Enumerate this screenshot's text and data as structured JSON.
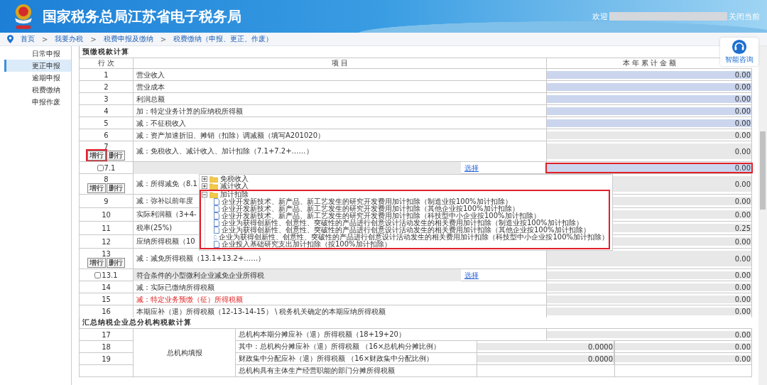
{
  "header": {
    "title": "国家税务总局江苏省电子税务局",
    "welcome": "欢迎",
    "close_link": "关闭当前"
  },
  "breadcrumb": {
    "separator": ">",
    "items": [
      "首页",
      "我要办税",
      "税费申报及缴纳",
      "税费缴纳（申报、更正、作废）"
    ]
  },
  "sidebar": {
    "items": [
      {
        "label": "日常申报",
        "selected": false
      },
      {
        "label": "更正申报",
        "selected": true
      },
      {
        "label": "逾期申报",
        "selected": false
      },
      {
        "label": "税费缴纳",
        "selected": false
      },
      {
        "label": "申报作废",
        "selected": false
      }
    ]
  },
  "help": {
    "label": "智能咨询"
  },
  "section1": {
    "title": "预缴税款计算",
    "columns": [
      "行 次",
      "项 目",
      "本 年 累 计 金 额"
    ],
    "rows": [
      {
        "no": "1",
        "item": "营业收入",
        "amount": "0.00",
        "kind": "prefilled"
      },
      {
        "no": "2",
        "item": "营业成本",
        "amount": "0.00",
        "kind": "prefilled"
      },
      {
        "no": "3",
        "item": "利润总额",
        "amount": "0.00",
        "kind": "prefilled"
      },
      {
        "no": "4",
        "item": "加：特定业务计算的应纳税所得额",
        "amount": "0.00",
        "kind": "prefilled"
      },
      {
        "no": "5",
        "item": "减：不征税收入",
        "amount": "0.00",
        "kind": "prefilled"
      },
      {
        "no": "6",
        "item": "减：资产加速折旧、摊销（扣除）调减额（填写A201020）",
        "amount": "0.00",
        "kind": "computed"
      },
      {
        "no": "7",
        "item": "减：免税收入、减计收入、加计扣除（7.1+7.2+……）",
        "amount": "0.00",
        "kind": "computed",
        "buttons": [
          {
            "label": "增行",
            "highlighted": true
          },
          {
            "label": "删行",
            "highlighted": false
          }
        ]
      },
      {
        "no": "7.1",
        "checkbox": {
          "checked": false
        },
        "item": "",
        "link": "选择",
        "amount": "0.00",
        "kind": "prefilled",
        "amount_highlighted": true,
        "tree": [
          {
            "label": "免税收入",
            "expanded": false,
            "highlighted": false
          },
          {
            "label": "减计收入",
            "expanded": false,
            "highlighted": false
          },
          {
            "label": "加计扣除",
            "expanded": true,
            "highlighted": true,
            "children": [
              "企业开发新技术、新产品、新工艺发生的研究开发费用加计扣除（制造业按100%加计扣除）",
              "企业开发新技术、新产品、新工艺发生的研究开发费用加计扣除（其他企业按100%加计扣除）",
              "企业开发新技术、新产品、新工艺发生的研究开发费用加计扣除（科技型中小企业按100%加计扣除）",
              "企业为获得创新性、创意性、突破性的产品进行创意设计活动发生的相关费用加计扣除（制造业按100%加计扣除）",
              "企业为获得创新性、创意性、突破性的产品进行创意设计活动发生的相关费用加计扣除（其他企业按100%加计扣除）",
              "企业为获得创新性、创意性、突破性的产品进行创意设计活动发生的相关费用加计扣除（科技型中小企业按100%加计扣除）",
              "企业投入基础研究支出加计扣除（按100%加计扣除）"
            ]
          }
        ]
      },
      {
        "no": "8",
        "item": "减：所得减免（8.1",
        "amount": "0.00",
        "kind": "computed",
        "buttons": [
          {
            "label": "增行",
            "highlighted": false
          },
          {
            "label": "删行",
            "highlighted": false
          }
        ]
      },
      {
        "no": "9",
        "item": "减：弥补以前年度",
        "amount": "0.00",
        "kind": "computed"
      },
      {
        "no": "10",
        "item": "实际利润额（3+4-",
        "amount": "0.00",
        "kind": "computed"
      },
      {
        "no": "11",
        "item": "税率(25%)",
        "amount": "0.25",
        "kind": "computed"
      },
      {
        "no": "12",
        "item": "应纳所得税额（10",
        "amount": "0.00",
        "kind": "computed"
      },
      {
        "no": "13",
        "item": "减：减免所得税额（13.1+13.2+……）",
        "amount": "0.00",
        "kind": "computed",
        "buttons": [
          {
            "label": "增行",
            "highlighted": false
          },
          {
            "label": "删行",
            "highlighted": false
          }
        ]
      },
      {
        "no": "13.1",
        "checkbox": {
          "checked": false
        },
        "item": "符合条件的小型微利企业减免企业所得税",
        "link": "选择",
        "amount": "0.00",
        "kind": "computed"
      },
      {
        "no": "14",
        "item": "减：实际已缴纳所得税额",
        "amount": "0.00",
        "kind": "computed"
      },
      {
        "no": "15",
        "item": "减：特定业务预缴（征）所得税额",
        "amount": "0.00",
        "kind": "computed",
        "warning": true
      },
      {
        "no": "16",
        "item": "本期应补（退）所得税额（12-13-14-15） \\ 税务机关确定的本期应纳所得税额",
        "amount": "0.00",
        "kind": "computed"
      }
    ]
  },
  "section2": {
    "title": "汇总纳税企业总分机构税款计算",
    "group_label": "总机构填报",
    "rows": [
      {
        "no": "17",
        "kind": "total",
        "item": "总机构本期分摊应补（退）所得税额（18+19+20）",
        "amount": "0.00"
      },
      {
        "no": "18",
        "kind": "ratio",
        "item": "其中：总机构分摊应补（退）所得税额 （16×总机构分摊比例）",
        "ratio": "0.0000",
        "amount": "0.00"
      },
      {
        "no": "19",
        "kind": "ratio",
        "item": "财政集中分配应补（退）所得税额 （16×财政集中分配比例）",
        "ratio": "0.0000",
        "amount": "0.00"
      },
      {
        "kind": "blank",
        "item": "总机构具有主体生产经营职能的部门分摊所得税额"
      }
    ]
  }
}
